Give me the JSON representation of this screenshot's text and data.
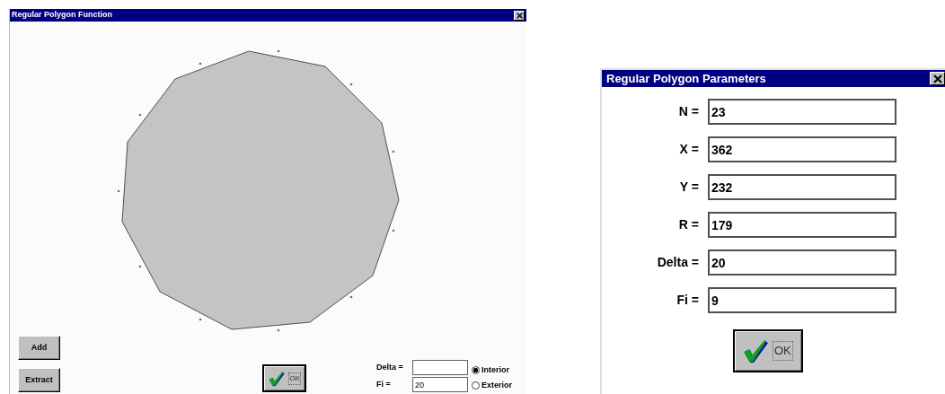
{
  "function_window": {
    "title": "Regular Polygon Function",
    "buttons": [
      {
        "label": "Add"
      },
      {
        "label": "Extract"
      }
    ],
    "ok_button": {
      "label": "OK"
    },
    "fields": [
      {
        "label": "Delta ="
      },
      {
        "label": "Fi =",
        "value": "20"
      }
    ],
    "radios": [
      {
        "label": "Interior",
        "selected": true
      },
      {
        "label": "Exterior",
        "selected": false
      }
    ]
  },
  "parameters_dialog": {
    "title": "Regular Polygon Parameters",
    "fields": [
      {
        "label": "N =",
        "value": "23"
      },
      {
        "label": "X =",
        "value": "362"
      },
      {
        "label": "Y =",
        "value": "232"
      },
      {
        "label": "R =",
        "value": "179"
      },
      {
        "label": "Delta =",
        "value": "20"
      },
      {
        "label": "Fi =",
        "value": "9"
      }
    ],
    "ok_button": {
      "label": "OK"
    }
  }
}
